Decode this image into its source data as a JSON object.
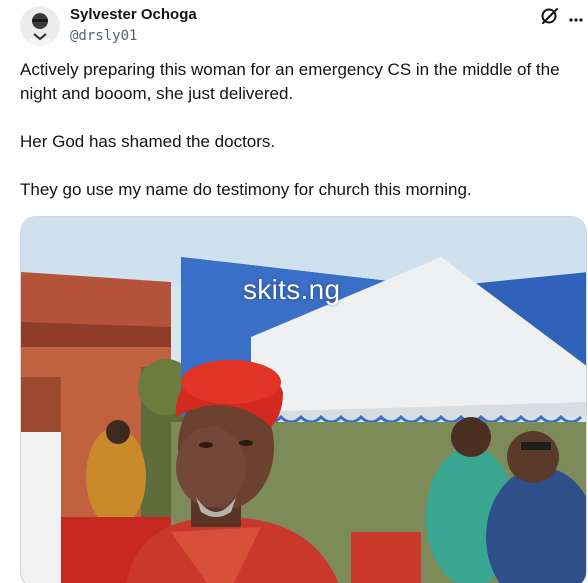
{
  "author": {
    "name": "Sylvester Ochoga",
    "handle": "@drsly01"
  },
  "icons": {
    "grok": "grok-slash-icon",
    "more": "more-icon"
  },
  "tweet": {
    "paragraphs": [
      "Actively preparing this woman for an emergency CS in the middle of the night and booom, she just delivered.",
      "Her God has shamed the doctors.",
      "They go use my name do testimony for church this morning."
    ]
  },
  "media": {
    "watermark": "skits.ng"
  },
  "colors": {
    "text": "#0f1419",
    "secondary": "#536471",
    "border": "#cfd9de"
  }
}
